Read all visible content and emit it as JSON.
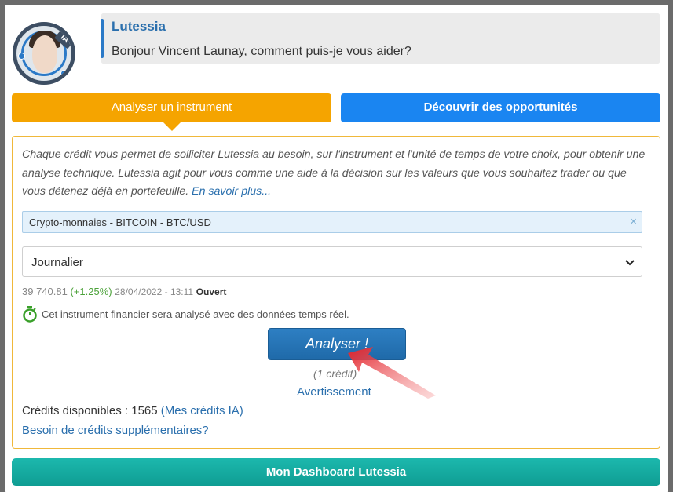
{
  "assistant": {
    "name": "Lutessia",
    "greeting": "Bonjour Vincent Launay, comment puis-je vous aider?",
    "avatar_badge": "IA"
  },
  "tabs": {
    "analyse_label": "Analyser un instrument",
    "discover_label": "Découvrir des opportunités"
  },
  "panel": {
    "description": "Chaque crédit vous permet de solliciter Lutessia au besoin, sur l'instrument et l'unité de temps de votre choix, pour obtenir une analyse technique. Lutessia agit pour vous comme une aide à la décision sur les valeurs que vous souhaitez trader ou que vous détenez déjà en portefeuille.",
    "learn_more": "En savoir plus...",
    "instrument_chip": "Crypto-monnaies - BITCOIN - BTC/USD",
    "chip_remove": "×",
    "timeframe_selected": "Journalier",
    "quote_price": "39 740.81",
    "quote_change": "(+1.25%)",
    "quote_datetime": "28/04/2022 - 13:11",
    "quote_status": "Ouvert",
    "realtime_text": "Cet instrument financier sera analysé avec des données temps réel.",
    "analyse_button": "Analyser !",
    "credit_cost": "(1 crédit)",
    "warning_link": "Avertissement",
    "credits_label": "Crédits disponibles : 1565",
    "my_credits_link": "(Mes crédits IA)",
    "more_credits_link": "Besoin de crédits supplémentaires?"
  },
  "dashboard_button": "Mon Dashboard Lutessia",
  "colors": {
    "tab_orange": "#f5a400",
    "tab_blue": "#1a85f1",
    "link_blue": "#2a6fad",
    "positive_green": "#4ca23a",
    "dashboard_teal": "#14ab9f",
    "arrow_red": "#e3222a"
  },
  "icons": {
    "stopwatch": "stopwatch-icon",
    "chevron": "chevron-down-icon",
    "arrow": "red-arrow-annotation"
  }
}
